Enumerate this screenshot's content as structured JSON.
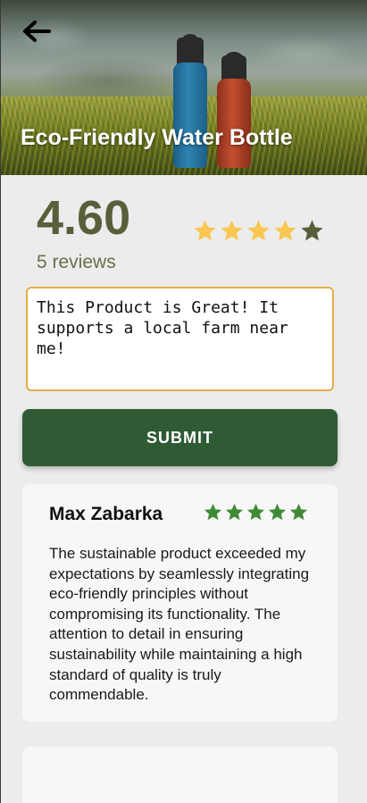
{
  "header": {
    "title": "Eco-Friendly Water Bottle",
    "back_icon": "arrow-left-icon"
  },
  "summary": {
    "rating": "4.60",
    "rating_value": 4.6,
    "rating_max": 5,
    "reviews_label": "5 reviews"
  },
  "review_input": {
    "value": "This Product is Great! It supports a local farm near me!"
  },
  "submit": {
    "label": "SUBMIT"
  },
  "reviews": [
    {
      "name": "Max Zabarka",
      "stars": 5,
      "text": "The sustainable product exceeded my expectations by seamlessly integrating eco-friendly principles without compromising its functionality. The attention to detail in ensuring sustainability while maintaining a high standard of quality is truly commendable."
    }
  ],
  "colors": {
    "accent_green": "#2e5b34",
    "star_gold": "#f7c752",
    "star_gray": "#5a5e3b",
    "star_green": "#3f8a34",
    "input_border": "#e4ae48",
    "rating_text": "#5a5e3b"
  }
}
